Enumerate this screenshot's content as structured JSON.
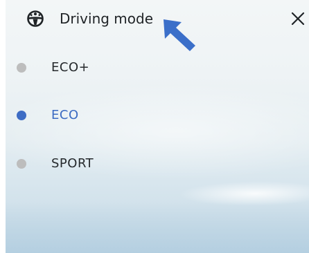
{
  "header": {
    "title": "Driving mode",
    "leading_icon": "steering-wheel-icon",
    "close_icon": "close-icon"
  },
  "annotation": {
    "icon": "pointer-arrow-icon",
    "color": "#3b6fc9"
  },
  "options": [
    {
      "label": "ECO+",
      "selected": false
    },
    {
      "label": "ECO",
      "selected": true
    },
    {
      "label": "SPORT",
      "selected": false
    }
  ],
  "colors": {
    "selected_dot": "#3d6cc4",
    "selected_text": "#3a6ac2",
    "unselected_dot": "#bdbdbd",
    "unselected_text": "#25292c",
    "title_text": "#1f2326"
  }
}
